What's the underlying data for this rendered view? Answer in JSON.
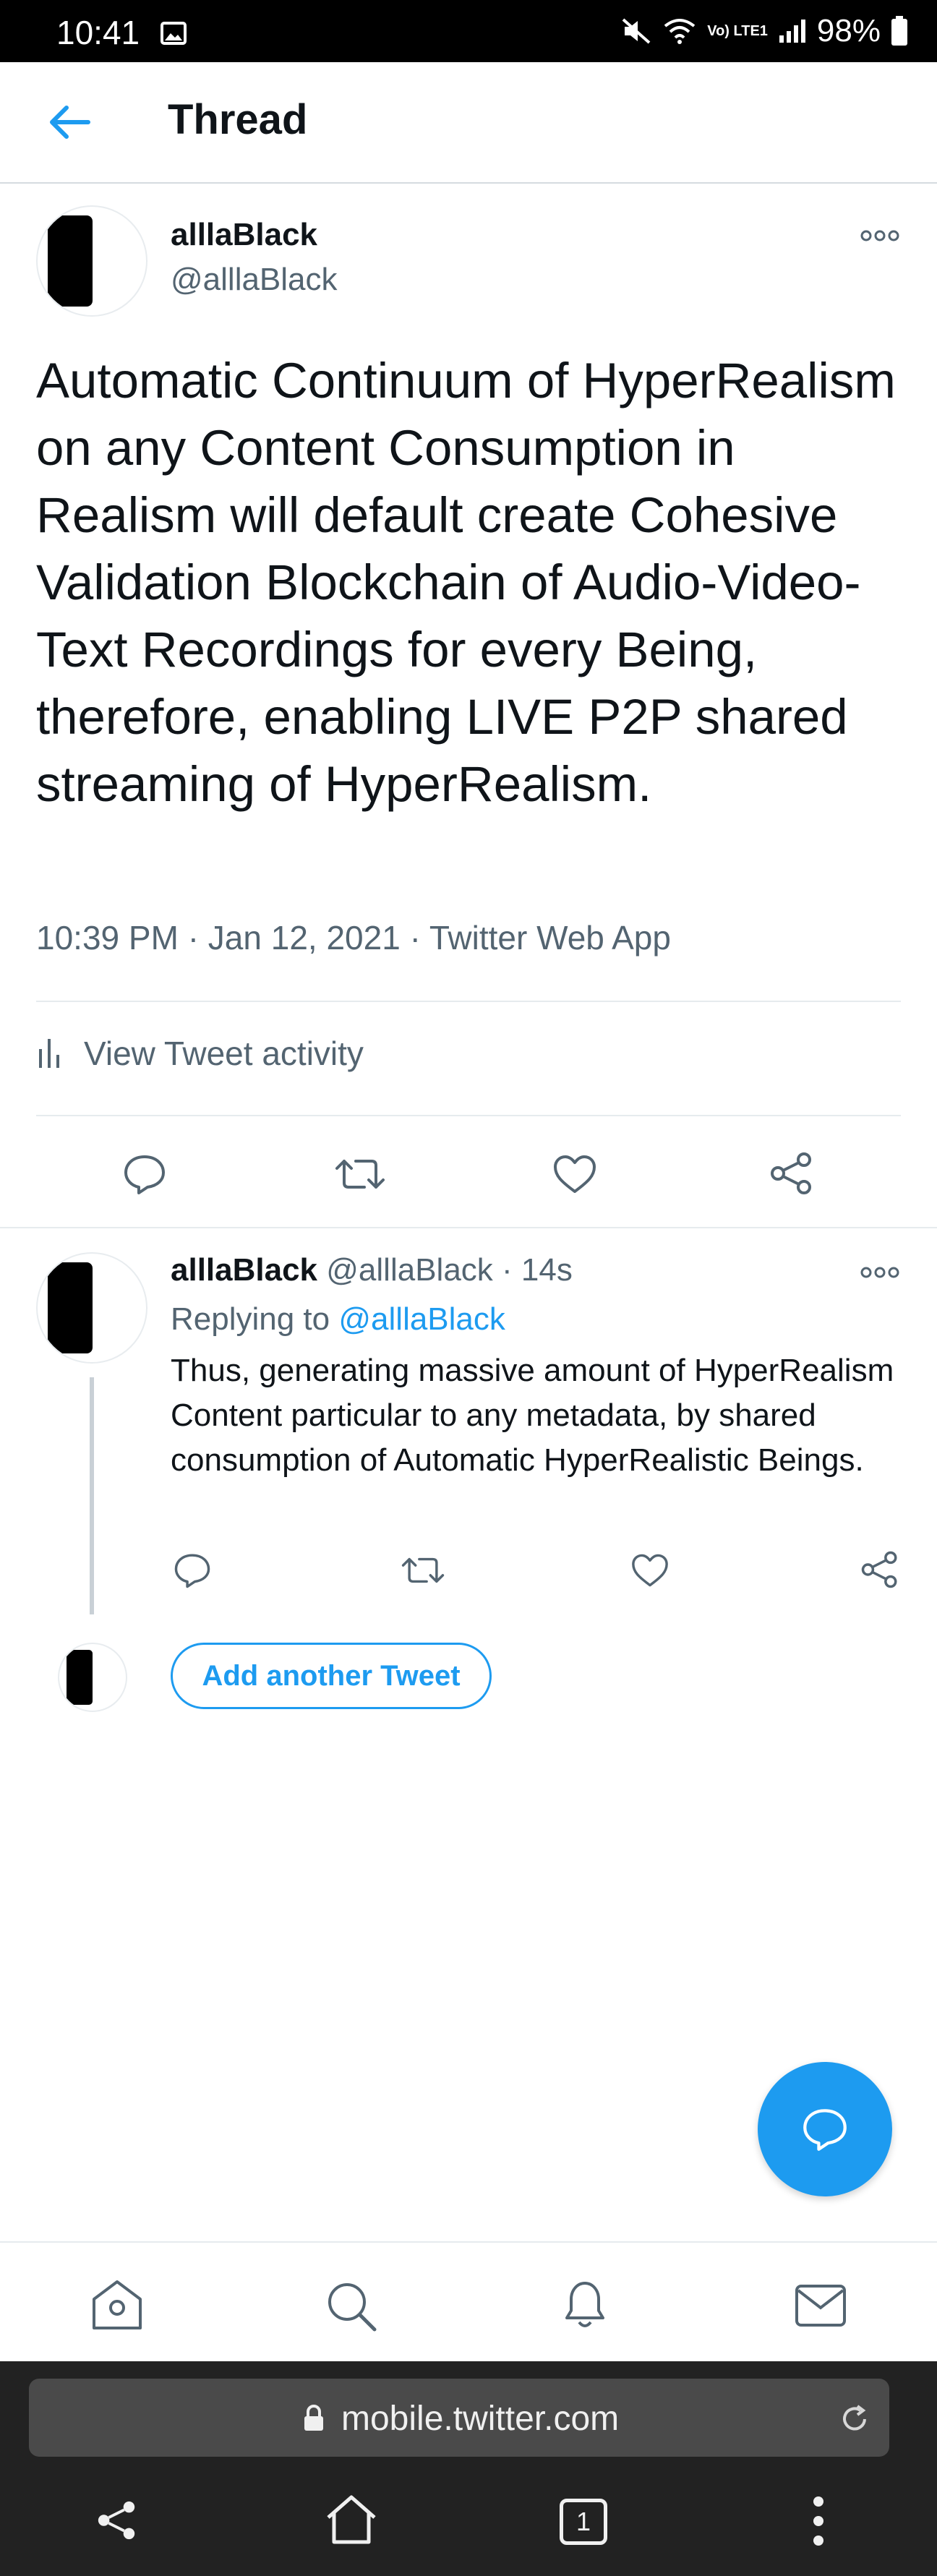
{
  "status_bar": {
    "time": "10:41",
    "battery": "98%",
    "network": "Vo) LTE1"
  },
  "header": {
    "title": "Thread"
  },
  "main_tweet": {
    "name": "alllaBlack",
    "handle": "@alllaBlack",
    "text": "Automatic Continuum of HyperRealism on any Content Consumption in Realism will default create Cohesive Validation Blockchain of Audio-Video-Text Recordings for every Being, therefore, enabling LIVE P2P shared streaming of HyperRealism.",
    "time": "10:39 PM",
    "date": "Jan 12, 2021",
    "source": "Twitter Web App",
    "activity_label": "View Tweet activity"
  },
  "reply": {
    "name": "alllaBlack",
    "handle": "@alllaBlack",
    "time": "14s",
    "replying_prefix": "Replying to",
    "replying_handle": "@alllaBlack",
    "text": "Thus, generating massive amount of HyperRealism Content particular to any metadata, by shared consumption of Automatic HyperRealistic Beings."
  },
  "compose": {
    "add_label": "Add another Tweet"
  },
  "browser": {
    "url": "mobile.twitter.com",
    "tab_count": "1"
  },
  "colors": {
    "accent": "#1d9bf0",
    "muted": "#536471",
    "text": "#0f1419"
  }
}
